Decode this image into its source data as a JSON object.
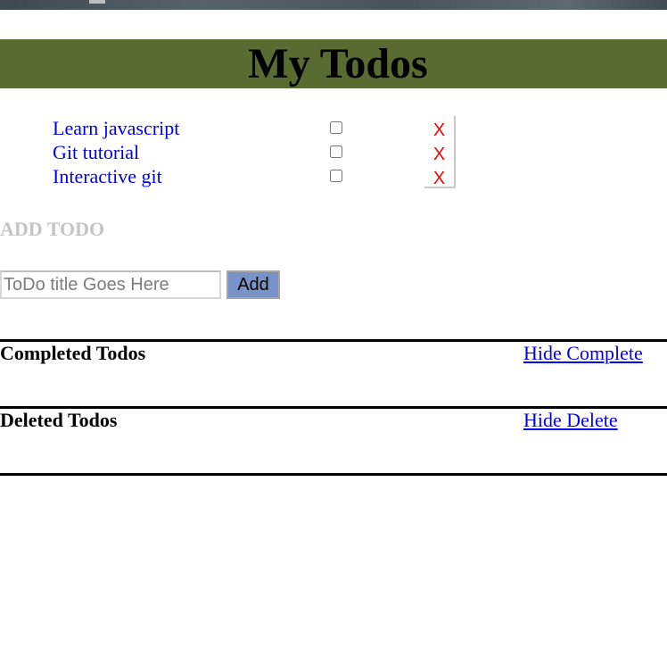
{
  "header": {
    "title": "My Todos",
    "banner_color": "#5a6b32"
  },
  "todos": [
    {
      "title": "Learn javascript",
      "completed": false,
      "delete_label": "X"
    },
    {
      "title": "Git tutorial",
      "completed": false,
      "delete_label": "X"
    },
    {
      "title": "Interactive git",
      "completed": false,
      "delete_label": "X"
    }
  ],
  "add_todo": {
    "heading": "ADD TODO",
    "input_placeholder": "ToDo title Goes Here",
    "input_value": "",
    "button_label": "Add",
    "button_color": "#7793c7"
  },
  "completed_section": {
    "title": "Completed Todos",
    "toggle_label": "Hide Complete"
  },
  "deleted_section": {
    "title": "Deleted Todos",
    "toggle_label": "Hide Delete"
  },
  "colors": {
    "link": "#0000ee",
    "delete": "#ff0000",
    "muted_heading": "#c4c4c4"
  }
}
